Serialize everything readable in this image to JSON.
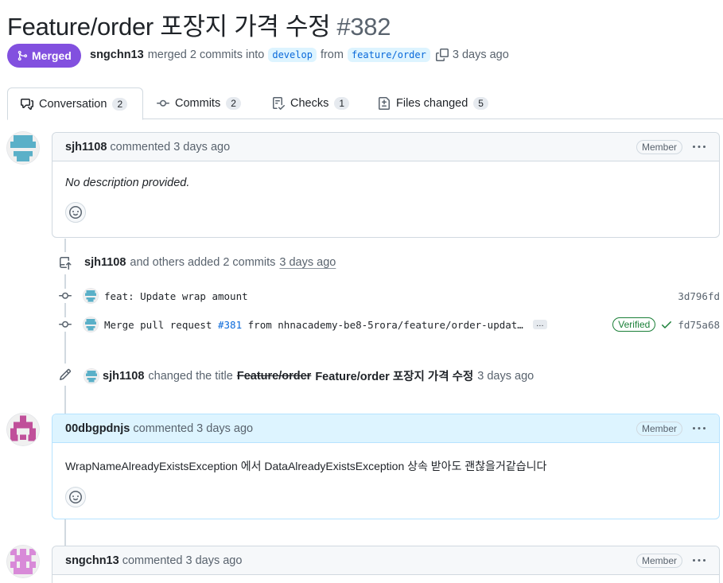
{
  "pr": {
    "title": "Feature/order 포장지 가격 수정",
    "number": "#382",
    "state_label": "Merged",
    "author": "sngchn13",
    "merged_text": "merged 2 commits into",
    "base_branch": "develop",
    "from_text": "from",
    "head_branch": "feature/order",
    "time": "3 days ago"
  },
  "tabs": [
    {
      "label": "Conversation",
      "count": "2",
      "icon": "comment-discussion-icon"
    },
    {
      "label": "Commits",
      "count": "2",
      "icon": "git-commit-icon"
    },
    {
      "label": "Checks",
      "count": "1",
      "icon": "checklist-icon"
    },
    {
      "label": "Files changed",
      "count": "5",
      "icon": "file-diff-icon"
    }
  ],
  "comments": [
    {
      "author": "sjh1108",
      "action": "commented 3 days ago",
      "role": "Member",
      "body": "No description provided."
    },
    {
      "author": "00dbgpdnjs",
      "action": "commented 3 days ago",
      "role": "Member",
      "body": "WrapNameAlreadyExistsException 에서 DataAlreadyExistsException 상속 받아도 괜찮을거같습니다"
    },
    {
      "author": "sngchn13",
      "action": "commented 3 days ago",
      "role": "Member"
    }
  ],
  "commits_event": {
    "author": "sjh1108",
    "text": "and others added 2 commits",
    "time": "3 days ago"
  },
  "commits": [
    {
      "message": "feat: Update wrap amount",
      "sha": "3d796fd"
    },
    {
      "message_prefix": "Merge pull request",
      "link": "#381",
      "message_suffix": "from nhnacademy-be8-5rora/feature/order-updat…",
      "ellipsis": "…",
      "verified": "Verified",
      "sha": "fd75a68"
    }
  ],
  "rename_event": {
    "author": "sjh1108",
    "text": "changed the title",
    "old_title": "Feature/order",
    "new_title": "Feature/order 포장지 가격 수정",
    "time": "3 days ago"
  },
  "colors": {
    "merged": "#8250df",
    "link": "#0969da",
    "verified": "#1a7f37"
  }
}
